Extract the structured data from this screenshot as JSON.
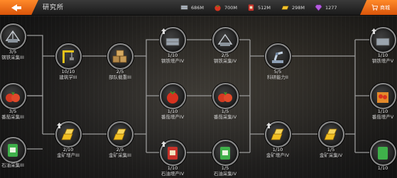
{
  "header": {
    "title": "研究所",
    "store_label": "商城",
    "resources": [
      {
        "icon": "steel-icon",
        "value": "686M"
      },
      {
        "icon": "tomato-icon",
        "value": "700M"
      },
      {
        "icon": "oil-icon",
        "value": "512M"
      },
      {
        "icon": "gold-icon",
        "value": "298M"
      },
      {
        "icon": "diamond-icon",
        "value": "1277"
      }
    ]
  },
  "nodes": [
    {
      "id": "n1",
      "count": "3/5",
      "name": "钢铁采集III",
      "icon": "steel-icon"
    },
    {
      "id": "n2",
      "count": "3/5",
      "name": "番茄采集III",
      "icon": "tomato-icon"
    },
    {
      "id": "n3",
      "count": "",
      "name": "石油采集III",
      "icon": "oil-icon"
    },
    {
      "id": "n4",
      "count": "10/10",
      "name": "建筑学III",
      "icon": "crane-icon"
    },
    {
      "id": "n5",
      "count": "2/5",
      "name": "部队载重III",
      "icon": "crates-icon"
    },
    {
      "id": "n6",
      "count": "2/10",
      "name": "金矿增产III",
      "icon": "gold-icon"
    },
    {
      "id": "n7",
      "count": "2/5",
      "name": "金矿采集III",
      "icon": "gold-icon"
    },
    {
      "id": "n8",
      "count": "1/10",
      "name": "钢铁增产IV",
      "icon": "steel-icon"
    },
    {
      "id": "n9",
      "count": "2/5",
      "name": "钢铁采集IV",
      "icon": "steel-icon"
    },
    {
      "id": "n10",
      "count": "1/10",
      "name": "番茄增产IV",
      "icon": "tomato-icon"
    },
    {
      "id": "n11",
      "count": "1/5",
      "name": "番茄采集IV",
      "icon": "tomato-icon"
    },
    {
      "id": "n12",
      "count": "1/10",
      "name": "石油增产IV",
      "icon": "oil-icon"
    },
    {
      "id": "n13",
      "count": "1/5",
      "name": "石油采集IV",
      "icon": "oil-icon"
    },
    {
      "id": "n14",
      "count": "5/5",
      "name": "科研能力II",
      "icon": "robot-arm-icon"
    },
    {
      "id": "n15",
      "count": "1/10",
      "name": "金矿增产IV",
      "icon": "gold-icon"
    },
    {
      "id": "n16",
      "count": "1/5",
      "name": "金矿采集IV",
      "icon": "gold-icon"
    },
    {
      "id": "n17",
      "count": "1/10",
      "name": "钢铁增产V",
      "icon": "steel-icon"
    },
    {
      "id": "n18",
      "count": "1/10",
      "name": "番茄增产V",
      "icon": "tomato-icon"
    },
    {
      "id": "n19",
      "count": "1/10",
      "name": "",
      "icon": "oil-icon"
    }
  ],
  "colors": {
    "accent": "#f07a1e",
    "node_border": "#8c8c8c",
    "link": "#9a9a9a"
  }
}
